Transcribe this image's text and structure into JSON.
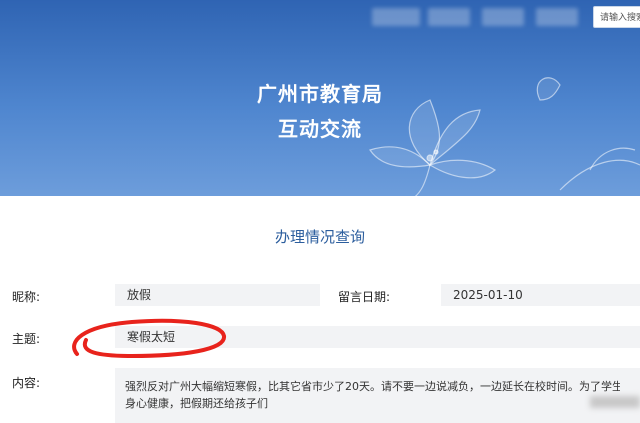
{
  "header": {
    "search_placeholder": "请输入搜索",
    "title_line1": "广州市教育局",
    "title_line2": "互动交流"
  },
  "section_title": "办理情况查询",
  "form": {
    "nickname_label": "昵称:",
    "nickname_value": "放假",
    "date_label": "留言日期:",
    "date_value": "2025-01-10",
    "subject_label": "主题:",
    "subject_value": "寒假太短",
    "content_label": "内容:",
    "content_line1": "强烈反对广州大幅缩短寒假，比其它省市少了20天。请不要一边说减负，一边延长在校时间。为了学生们的",
    "content_line2": "身心健康，把假期还给孩子们"
  },
  "colors": {
    "banner": "#3a72c0",
    "section_title": "#2c5e9e",
    "field_bg": "#f2f3f5",
    "annotation": "#e8231c"
  }
}
